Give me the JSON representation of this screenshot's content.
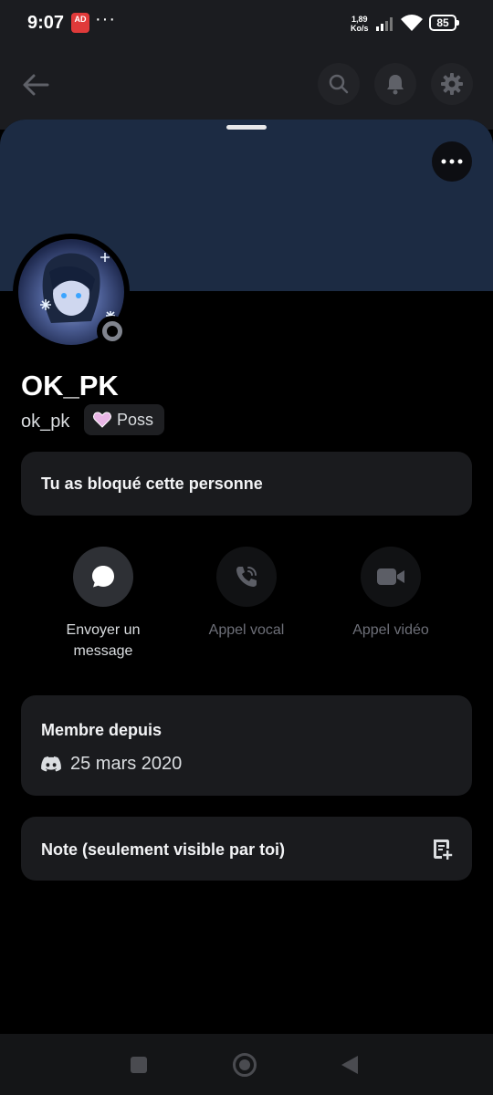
{
  "status_bar": {
    "time": "9:07",
    "ad_badge": "AD",
    "more": "···",
    "speed_value": "1,89",
    "speed_unit": "Ko/s",
    "battery": "85"
  },
  "profile": {
    "display_name": "OK_PK",
    "username": "ok_pk",
    "tag_label": "Poss",
    "blocked_text": "Tu as bloqué cette personne"
  },
  "actions": [
    {
      "label": "Envoyer un message",
      "icon": "chat-bubble-icon",
      "enabled": true
    },
    {
      "label": "Appel vocal",
      "icon": "phone-icon",
      "enabled": false
    },
    {
      "label": "Appel vidéo",
      "icon": "video-camera-icon",
      "enabled": false
    }
  ],
  "member_since": {
    "title": "Membre depuis",
    "date": "25 mars 2020",
    "icon": "discord-icon"
  },
  "note": {
    "label": "Note (seulement visible par toi)",
    "icon": "note-add-icon"
  },
  "colors": {
    "banner": "#1c2b43",
    "card": "#1a1b1e",
    "status_offline": "#80848e"
  }
}
